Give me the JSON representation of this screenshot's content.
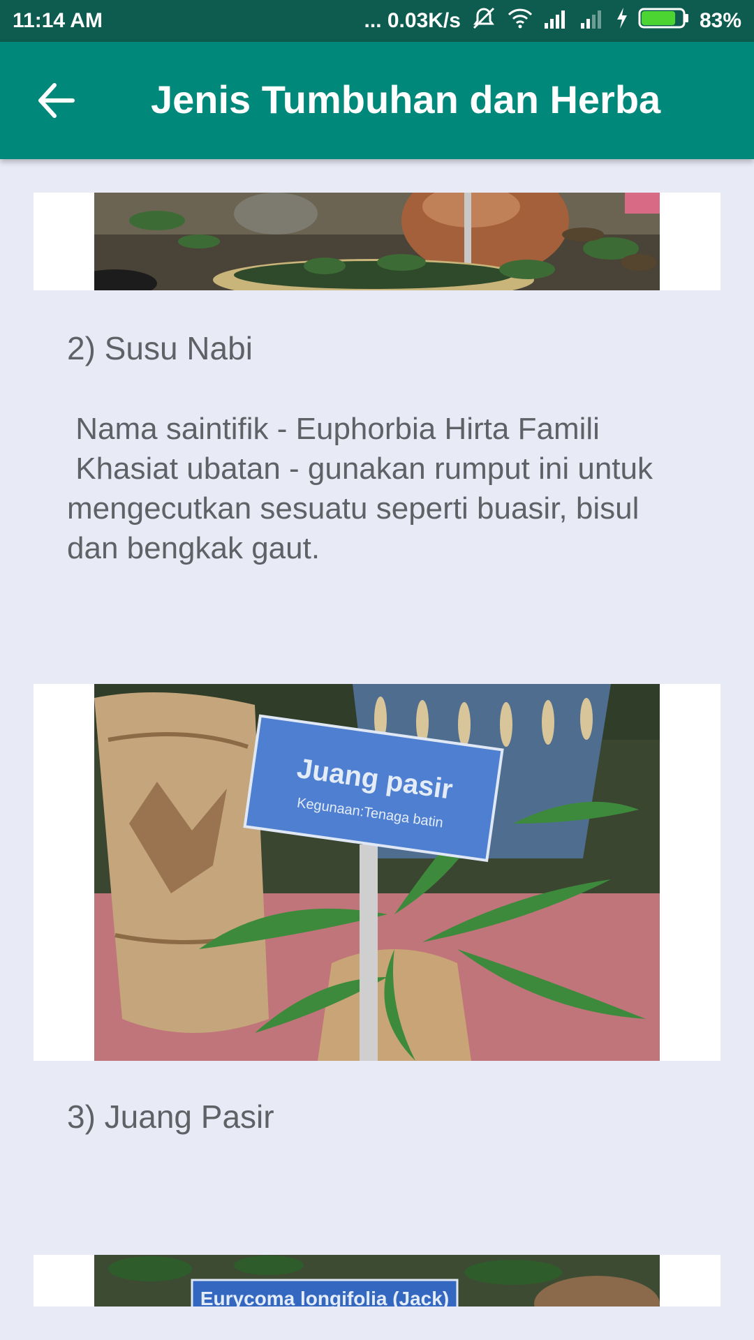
{
  "status_bar": {
    "time": "11:14 AM",
    "network_speed": "... 0.03K/s",
    "battery_percent": "83%",
    "battery_level": 0.83,
    "icons": [
      "mute-icon",
      "wifi-icon",
      "signal-icon",
      "signal-icon-2",
      "charging-icon",
      "battery-icon"
    ]
  },
  "app_bar": {
    "title": "Jenis Tumbuhan dan Herba",
    "back_icon": "arrow-back-icon",
    "color": "#00897b"
  },
  "items": [
    {
      "image": "potted herb plants photo (partially visible)"
    },
    {
      "title": "2) Susu Nabi",
      "description": " Nama saintifik - Euphorbia Hirta Famili\n Khasiat ubatan - gunakan rumput ini untuk mengecutkan sesuatu seperti buasir, bisul dan bengkak gaut."
    },
    {
      "image_sign_title": "Juang pasir",
      "image_sign_subtitle": "Kegunaan:Tenaga batin",
      "title": "3) Juang Pasir"
    },
    {
      "image_sign_title": "Eurycoma longifolia (Jack)"
    }
  ]
}
